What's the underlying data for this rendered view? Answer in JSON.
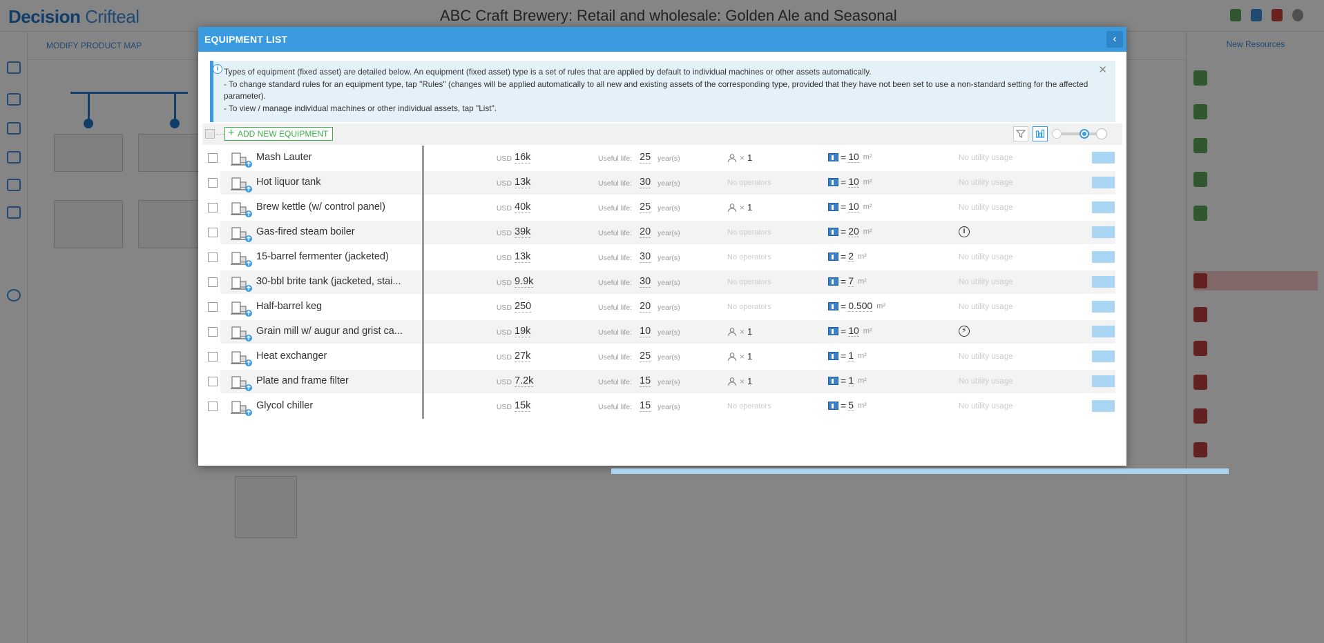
{
  "background": {
    "logo_bold": "Decision",
    "logo_light": "Crifteal",
    "app_title": "ABC Craft Brewery: Retail and wholesale: Golden Ale and Seasonal",
    "subbar_label": "Modify product map",
    "right_panel_header": "New Resources"
  },
  "modal": {
    "title": "EQUIPMENT LIST",
    "back_icon": "chevron-left-icon",
    "info": {
      "line1": "Types of equipment (fixed asset) are detailed below. An equipment (fixed asset) type is a set of rules that are applied by default to individual machines or other assets automatically.",
      "line2": "- To change standard rules for an equipment type, tap \"Rules\" (changes will be applied automatically to all new and existing assets of the corresponding type, provided that they have not been set to use a non-standard setting for the affected parameter).",
      "line3": "- To view / manage individual machines or other individual assets, tap \"List\"."
    },
    "toolbar": {
      "add_label": "ADD NEW EQUIPMENT",
      "filter_icon": "filter-icon",
      "chart_icon": "bar-chart-icon"
    },
    "labels": {
      "currency": "USD",
      "useful_life": "Useful life:",
      "years": "year(s)",
      "no_operators": "No operators",
      "area_unit": "m²",
      "no_utility": "No utility usage",
      "op_times": "×"
    },
    "rows": [
      {
        "name": "Mash Lauter",
        "cost": "16k",
        "life": "25",
        "operators": "1",
        "area": "10",
        "utility": "none"
      },
      {
        "name": "Hot liquor tank",
        "cost": "13k",
        "life": "30",
        "operators": "",
        "area": "10",
        "utility": "none"
      },
      {
        "name": "Brew kettle (w/ control panel)",
        "cost": "40k",
        "life": "25",
        "operators": "1",
        "area": "10",
        "utility": "none"
      },
      {
        "name": "Gas-fired steam boiler",
        "cost": "39k",
        "life": "20",
        "operators": "",
        "area": "20",
        "utility": "info"
      },
      {
        "name": "15-barrel fermenter (jacketed)",
        "cost": "13k",
        "life": "30",
        "operators": "",
        "area": "2",
        "utility": "none"
      },
      {
        "name": "30-bbl brite tank (jacketed, stai...",
        "cost": "9.9k",
        "life": "30",
        "operators": "",
        "area": "7",
        "utility": "none"
      },
      {
        "name": "Half-barrel keg",
        "cost": "250",
        "life": "20",
        "operators": "",
        "area": "0.500",
        "utility": "none"
      },
      {
        "name": "Grain mill w/ augur and grist ca...",
        "cost": "19k",
        "life": "10",
        "operators": "1",
        "area": "10",
        "utility": "power"
      },
      {
        "name": "Heat exchanger",
        "cost": "27k",
        "life": "25",
        "operators": "1",
        "area": "1",
        "utility": "none"
      },
      {
        "name": "Plate and frame filter",
        "cost": "7.2k",
        "life": "15",
        "operators": "1",
        "area": "1",
        "utility": "none"
      },
      {
        "name": "Glycol chiller",
        "cost": "15k",
        "life": "15",
        "operators": "",
        "area": "5",
        "utility": "none"
      }
    ]
  }
}
